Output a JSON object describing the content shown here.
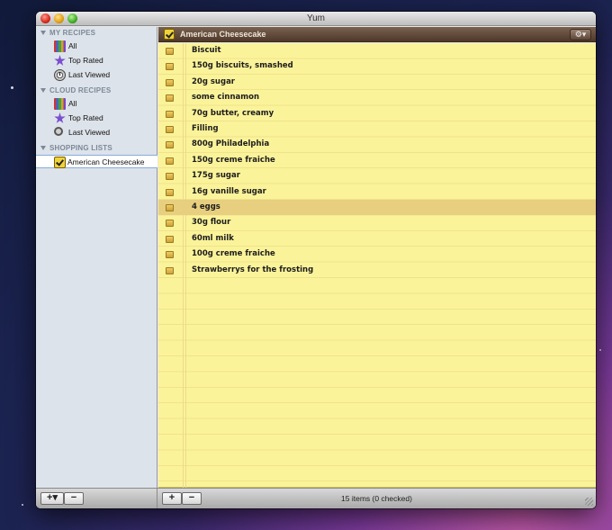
{
  "window": {
    "title": "Yum"
  },
  "sidebar": {
    "sections": [
      {
        "title": "MY RECIPES",
        "items": [
          {
            "label": "All",
            "icon": "books-icon"
          },
          {
            "label": "Top Rated",
            "icon": "star-icon"
          },
          {
            "label": "Last Viewed",
            "icon": "clock-icon"
          }
        ]
      },
      {
        "title": "CLOUD RECIPES",
        "items": [
          {
            "label": "All",
            "icon": "books-icon"
          },
          {
            "label": "Top Rated",
            "icon": "star-icon"
          },
          {
            "label": "Last Viewed",
            "icon": "search-icon"
          }
        ]
      },
      {
        "title": "SHOPPING LISTS",
        "items": [
          {
            "label": "American Cheesecake",
            "icon": "checklist-icon",
            "selected": true
          }
        ]
      }
    ],
    "add_label": "+▾",
    "remove_label": "−"
  },
  "list": {
    "title": "American Cheesecake",
    "gear_label": "⚙▾",
    "items": [
      "Biscuit",
      "150g biscuits, smashed",
      "20g sugar",
      "some cinnamon",
      "70g butter, creamy",
      "Filling",
      "800g Philadelphia",
      "150g creme fraiche",
      "175g sugar",
      "16g vanille sugar",
      "4 eggs",
      "30g flour",
      "60ml milk",
      "100g creme fraiche",
      "Strawberrys for the frosting"
    ],
    "selected_index": 10
  },
  "footer": {
    "add_label": "+",
    "remove_label": "−",
    "status": "15 items (0 checked)"
  }
}
